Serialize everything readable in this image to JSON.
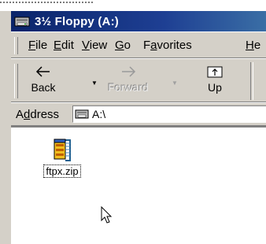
{
  "window": {
    "title": "3½ Floppy (A:)"
  },
  "menu": {
    "items": [
      {
        "pre": "",
        "u": "F",
        "post": "ile"
      },
      {
        "pre": "",
        "u": "E",
        "post": "dit"
      },
      {
        "pre": "",
        "u": "V",
        "post": "iew"
      },
      {
        "pre": "",
        "u": "G",
        "post": "o"
      },
      {
        "pre": "F",
        "u": "a",
        "post": "vorites"
      },
      {
        "pre": "",
        "u": "H",
        "post": "e"
      }
    ]
  },
  "toolbar": {
    "back_label": "Back",
    "forward_label": "Forward",
    "up_label": "Up"
  },
  "address": {
    "label_pre": "A",
    "label_u": "d",
    "label_post": "dress",
    "value": "A:\\"
  },
  "files": [
    {
      "name": "ftpx.zip",
      "icon": "zip-file-icon"
    }
  ],
  "icons": {
    "title": "floppy-drive-icon",
    "address": "floppy-drive-icon",
    "cursor": "mouse-pointer-icon"
  },
  "colors": {
    "titlebar_start": "#0a246a",
    "titlebar_end": "#3a6ea5",
    "face": "#d4d0c8"
  }
}
